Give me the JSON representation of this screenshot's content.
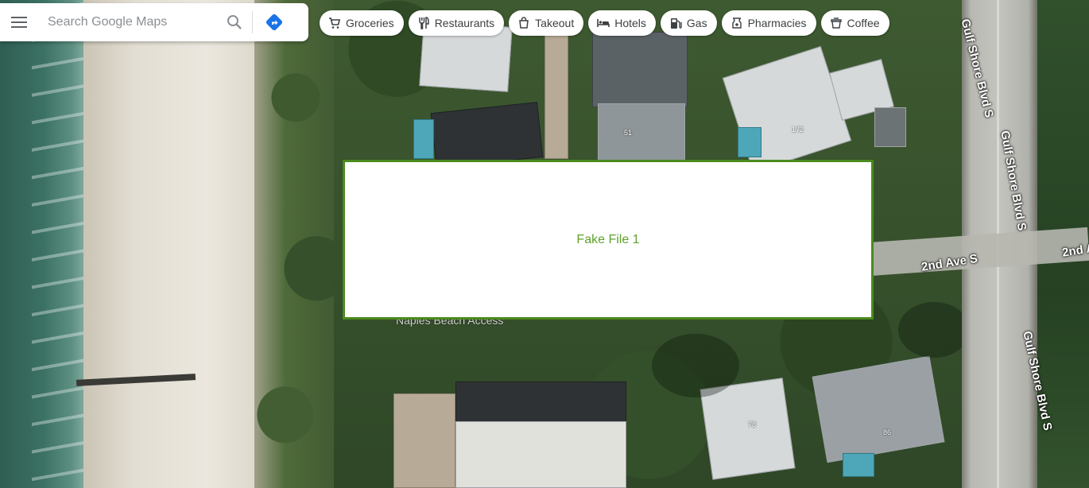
{
  "search": {
    "placeholder": "Search Google Maps",
    "menu_icon": "menu-icon",
    "search_icon": "search-icon",
    "directions_icon": "directions-icon"
  },
  "chips": [
    {
      "label": "Groceries",
      "icon": "cart-icon"
    },
    {
      "label": "Restaurants",
      "icon": "fork-knife-icon"
    },
    {
      "label": "Takeout",
      "icon": "takeout-bag-icon"
    },
    {
      "label": "Hotels",
      "icon": "bed-icon"
    },
    {
      "label": "Gas",
      "icon": "gas-pump-icon"
    },
    {
      "label": "Pharmacies",
      "icon": "pharmacy-icon"
    },
    {
      "label": "Coffee",
      "icon": "coffee-cup-icon"
    }
  ],
  "map": {
    "type": "satellite",
    "roads": [
      {
        "name": "Gulf Shore Blvd S"
      },
      {
        "name": "Gulf Shore Blvd S"
      },
      {
        "name": "Gulf Shore Blvd S"
      },
      {
        "name": "2nd Ave S"
      },
      {
        "name": "2nd A"
      }
    ],
    "poi": "Naples Beach Access",
    "house_numbers": [
      "51",
      "172",
      "78",
      "86"
    ]
  },
  "overlay": {
    "label": "Fake File 1",
    "border_color": "#4c8a1f",
    "text_color": "#5ea12c"
  }
}
